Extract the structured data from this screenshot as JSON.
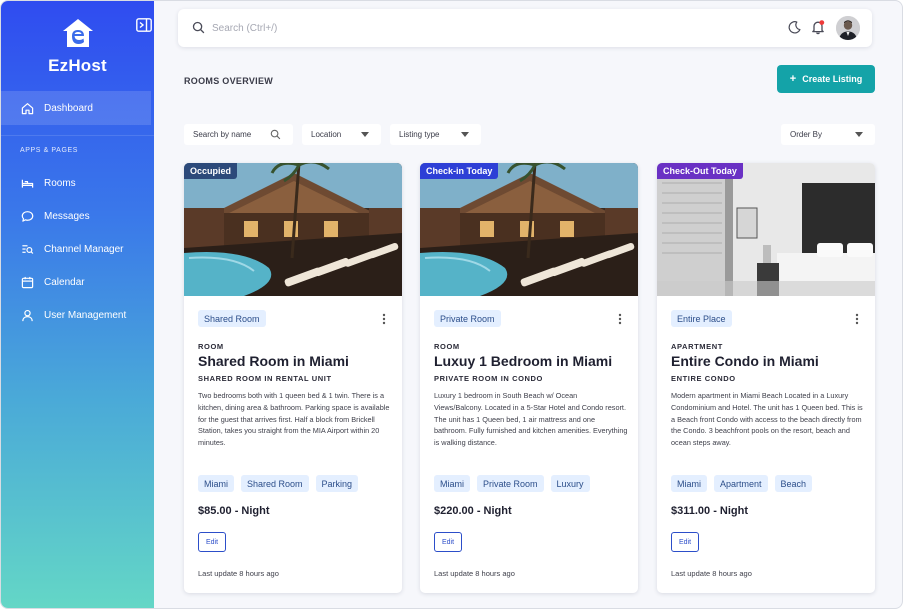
{
  "app": {
    "name": "EzHost"
  },
  "sidebar": {
    "dashboard_label": "Dashboard",
    "section_label": "APPS & PAGES",
    "items": [
      {
        "label": "Rooms",
        "icon": "bed-icon"
      },
      {
        "label": "Messages",
        "icon": "chat-icon"
      },
      {
        "label": "Channel Manager",
        "icon": "channel-search-icon"
      },
      {
        "label": "Calendar",
        "icon": "calendar-icon"
      },
      {
        "label": "User Management",
        "icon": "user-icon"
      }
    ]
  },
  "topbar": {
    "search_placeholder": "Search (Ctrl+/)"
  },
  "header": {
    "title": "ROOMS OVERVIEW",
    "create_label": "Create Listing"
  },
  "filters": {
    "search_name": "Search by name",
    "location": "Location",
    "listing_type": "Listing type",
    "order_by": "Order By"
  },
  "colors": {
    "accent": "#14a3a8",
    "occupied": "#2c4a7a",
    "checkin": "#2d3fd6",
    "checkout": "#6a31c4",
    "chip_bg": "#e4efff"
  },
  "cards": [
    {
      "status": "Occupied",
      "type_chip": "Shared Room",
      "category": "ROOM",
      "title": "Shared Room in Miami",
      "subtitle": "SHARED ROOM IN RENTAL UNIT",
      "description": "Two bedrooms both with 1 queen bed & 1 twin. There is a kitchen, dining area & bathroom. Parking space is available for the guest that arrives first. Half a block from Brickell Station, takes you straight from the MIA Airport within 20 minutes.",
      "tags": [
        "Miami",
        "Shared Room",
        "Parking"
      ],
      "price": "$85.00 - Night",
      "edit_label": "Edit",
      "updated": "Last update 8 hours ago"
    },
    {
      "status": "Check-in Today",
      "type_chip": "Private Room",
      "category": "ROOM",
      "title": "Luxuy 1 Bedroom in Miami",
      "subtitle": "PRIVATE ROOM IN CONDO",
      "description": "Luxury 1 bedroom in South Beach w/ Ocean Views/Balcony. Located in a 5-Star Hotel and Condo resort. The unit has 1 Queen bed, 1 air mattress and one bathroom. Fully furnished and kitchen amenities. Everything is walking distance.",
      "tags": [
        "Miami",
        "Private Room",
        "Luxury"
      ],
      "price": "$220.00 - Night",
      "edit_label": "Edit",
      "updated": "Last update 8 hours ago"
    },
    {
      "status": "Check-Out Today",
      "type_chip": "Entire Place",
      "category": "APARTMENT",
      "title": "Entire Condo in Miami",
      "subtitle": "ENTIRE CONDO",
      "description": "Modern apartment in Miami Beach Located in a Luxury Condominium and Hotel. The unit has 1 Queen bed. This is a Beach front Condo with access to the beach directly from the Condo. 3 beachfront pools on the resort, beach and ocean steps away.",
      "tags": [
        "Miami",
        "Apartment",
        "Beach"
      ],
      "price": "$311.00 - Night",
      "edit_label": "Edit",
      "updated": "Last update 8 hours ago"
    }
  ]
}
